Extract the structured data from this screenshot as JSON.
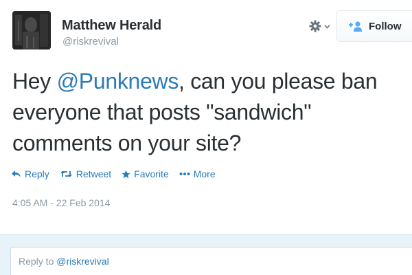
{
  "user": {
    "name": "Matthew Herald",
    "handle": "@riskrevival"
  },
  "header": {
    "follow_label": "Follow",
    "gear_icon": "gear-icon",
    "dropdown_icon": "chevron-down-icon",
    "follow_icon": "add-user-icon"
  },
  "tweet": {
    "text_before": "Hey ",
    "mention": "@Punknews",
    "text_after": ", can you please ban everyone that posts \"sandwich\" comments on your site?",
    "timestamp": "4:05 AM - 22 Feb 2014"
  },
  "actions": [
    {
      "label": "Reply",
      "icon": "reply-icon"
    },
    {
      "label": "Retweet",
      "icon": "retweet-icon"
    },
    {
      "label": "Favorite",
      "icon": "star-icon"
    },
    {
      "label": "More",
      "icon": "more-dots-icon"
    }
  ],
  "reply": {
    "prefix": "Reply to ",
    "handle": "@riskrevival"
  },
  "colors": {
    "link": "#2b7bb9",
    "text": "#292f33",
    "muted": "#8899a6",
    "reply_bar": "#e8f3f9"
  }
}
